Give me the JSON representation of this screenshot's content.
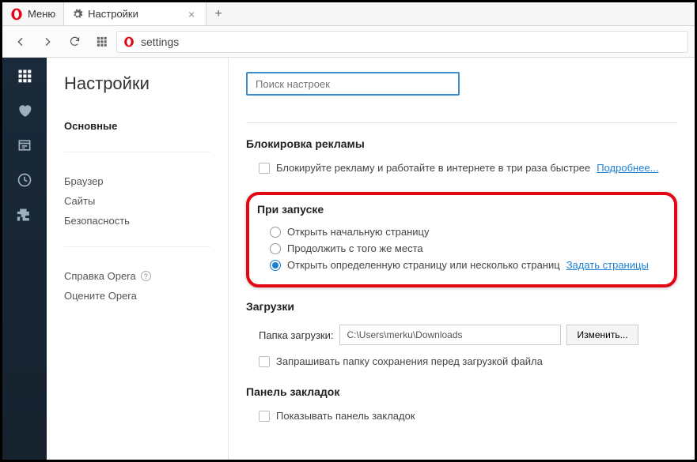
{
  "titlebar": {
    "menu_label": "Меню",
    "tab_label": "Настройки"
  },
  "addressbar": {
    "url": "settings"
  },
  "nav": {
    "title": "Настройки",
    "items": [
      "Основные",
      "Браузер",
      "Сайты",
      "Безопасность"
    ],
    "footer": [
      "Справка Opera",
      "Оцените Opera"
    ]
  },
  "content": {
    "search_placeholder": "Поиск настроек",
    "adblock": {
      "title": "Блокировка рекламы",
      "checkbox_label": "Блокируйте рекламу и работайте в интернете в три раза быстрее",
      "learn_more": "Подробнее..."
    },
    "startup": {
      "title": "При запуске",
      "options": [
        "Открыть начальную страницу",
        "Продолжить с того же места",
        "Открыть определенную страницу или несколько страниц"
      ],
      "set_pages_link": "Задать страницы",
      "selected_index": 2
    },
    "downloads": {
      "title": "Загрузки",
      "folder_label": "Папка загрузки:",
      "folder_path": "C:\\Users\\merku\\Downloads",
      "change_button": "Изменить...",
      "ask_label": "Запрашивать папку сохранения перед загрузкой файла"
    },
    "bookmarks": {
      "title": "Панель закладок",
      "show_label": "Показывать панель закладок"
    }
  }
}
